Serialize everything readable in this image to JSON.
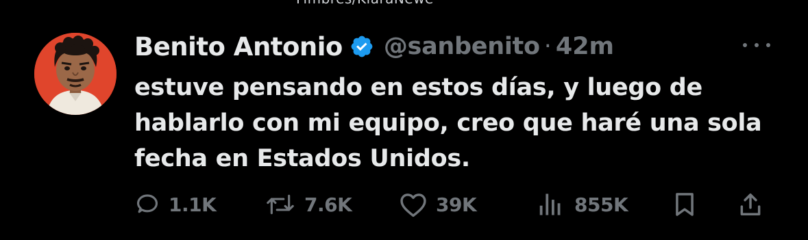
{
  "top_banner": {
    "text": "Fimbres/KlaraNewe"
  },
  "tweet": {
    "author": {
      "display_name": "Benito Antonio",
      "handle": "@sanbenito",
      "verified": true,
      "avatar_icon": "profile-photo"
    },
    "separator": "·",
    "timestamp": "42m",
    "text": "estuve pensando en estos días, y luego de hablarlo con mi equipo, creo que haré una sola fecha en Estados Unidos.",
    "actions": {
      "replies": "1.1K",
      "reposts": "7.6K",
      "likes": "39K",
      "views": "855K"
    }
  },
  "icons": {
    "verified": "verified-badge-icon",
    "more": "more-dots-icon",
    "reply": "reply-icon",
    "repost": "repost-icon",
    "like": "heart-icon",
    "views": "views-icon",
    "bookmark": "bookmark-icon",
    "share": "share-icon"
  },
  "colors": {
    "background": "#000000",
    "text_primary": "#e7e9ea",
    "text_secondary": "#71767b",
    "verified_blue": "#1d9bf0",
    "avatar_background": "#e0452c"
  }
}
